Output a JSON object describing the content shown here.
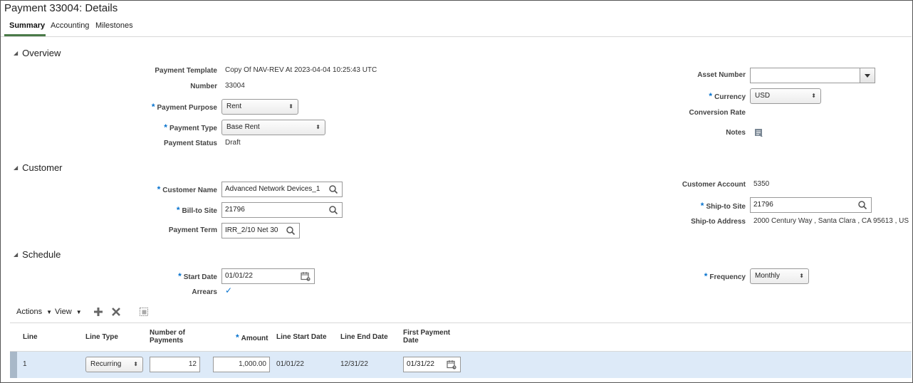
{
  "page": {
    "title": "Payment 33004: Details"
  },
  "tabs": [
    {
      "label": "Summary",
      "active": true
    },
    {
      "label": "Accounting",
      "active": false
    },
    {
      "label": "Milestones",
      "active": false
    }
  ],
  "overview": {
    "heading": "Overview",
    "payment_template": {
      "label": "Payment Template",
      "value": "Copy Of NAV-REV At 2023-04-04 10:25:43 UTC"
    },
    "number": {
      "label": "Number",
      "value": "33004"
    },
    "payment_purpose": {
      "label": "Payment Purpose",
      "value": "Rent"
    },
    "payment_type": {
      "label": "Payment Type",
      "value": "Base Rent"
    },
    "payment_status": {
      "label": "Payment Status",
      "value": "Draft"
    },
    "asset_number": {
      "label": "Asset Number",
      "value": ""
    },
    "currency": {
      "label": "Currency",
      "value": "USD"
    },
    "conversion_rate": {
      "label": "Conversion Rate",
      "value": ""
    },
    "notes": {
      "label": "Notes",
      "icon": "notes-icon"
    }
  },
  "customer": {
    "heading": "Customer",
    "customer_name": {
      "label": "Customer Name",
      "value": "Advanced Network Devices_1"
    },
    "bill_to_site": {
      "label": "Bill-to Site",
      "value": "21796"
    },
    "payment_term": {
      "label": "Payment Term",
      "value": "IRR_2/10 Net 30"
    },
    "customer_account": {
      "label": "Customer Account",
      "value": "5350"
    },
    "ship_to_site": {
      "label": "Ship-to Site",
      "value": "21796"
    },
    "ship_to_address": {
      "label": "Ship-to Address",
      "value": "2000 Century Way , Santa Clara , CA 95613 , US"
    }
  },
  "schedule": {
    "heading": "Schedule",
    "start_date": {
      "label": "Start Date",
      "value": "01/01/22"
    },
    "arrears": {
      "label": "Arrears",
      "checked": true,
      "mark": "✓"
    },
    "frequency": {
      "label": "Frequency",
      "value": "Monthly"
    }
  },
  "toolbar": {
    "actions": "Actions",
    "view": "View"
  },
  "table": {
    "headers": {
      "line": "Line",
      "line_type": "Line Type",
      "num_payments_1": "Number of",
      "num_payments_2": "Payments",
      "amount": "Amount",
      "line_start": "Line Start Date",
      "line_end": "Line End Date",
      "first_payment_1": "First Payment",
      "first_payment_2": "Date"
    },
    "rows": [
      {
        "line": "1",
        "line_type": "Recurring",
        "num_payments": "12",
        "amount": "1,000.00",
        "line_start": "01/01/22",
        "line_end": "12/31/22",
        "first_payment": "01/31/22"
      }
    ]
  },
  "colors": {
    "required": "#0572ce",
    "selected_row": "#ddeaf8",
    "tab_accent": "#4a7a48"
  }
}
